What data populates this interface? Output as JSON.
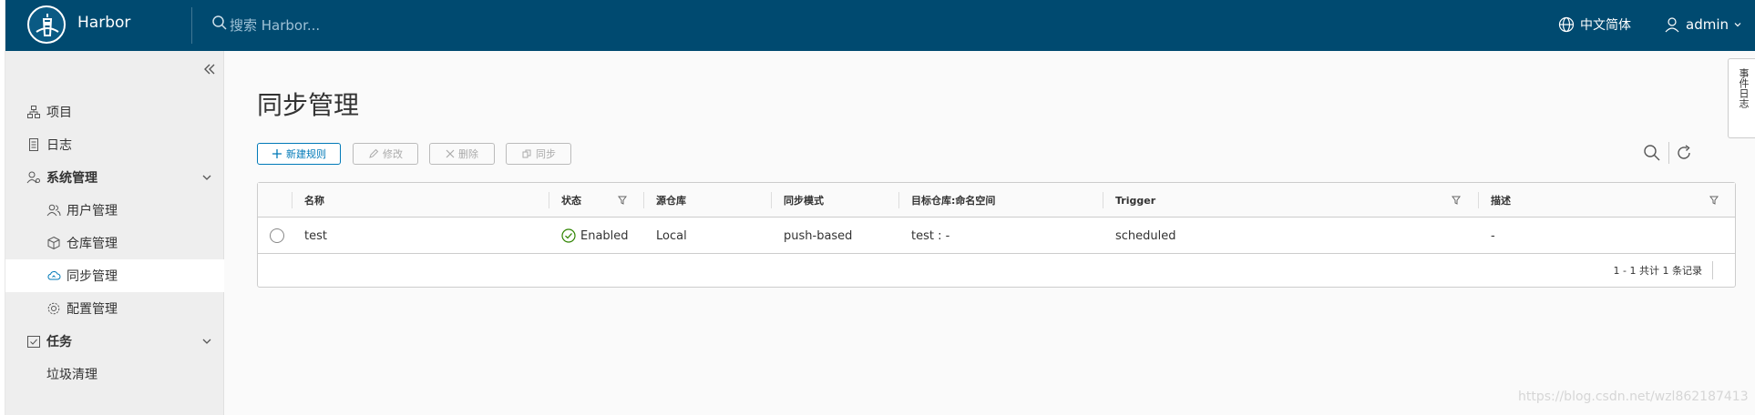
{
  "header": {
    "brand": "Harbor",
    "search_placeholder": "搜索 Harbor...",
    "language": "中文简体",
    "user": "admin"
  },
  "sidebar": {
    "items": [
      {
        "label": "项目",
        "icon": "project-icon"
      },
      {
        "label": "日志",
        "icon": "log-icon"
      },
      {
        "label": "系统管理",
        "icon": "system-admin-icon",
        "expanded": true
      },
      {
        "label": "用户管理",
        "icon": "users-icon"
      },
      {
        "label": "仓库管理",
        "icon": "registry-icon"
      },
      {
        "label": "同步管理",
        "icon": "cloud-sync-icon",
        "active": true
      },
      {
        "label": "配置管理",
        "icon": "gear-icon"
      },
      {
        "label": "任务",
        "icon": "task-icon",
        "expanded": true
      },
      {
        "label": "垃圾清理"
      }
    ]
  },
  "page": {
    "title": "同步管理"
  },
  "toolbar": {
    "new_rule": "新建规则",
    "edit": "修改",
    "delete": "删除",
    "replicate": "同步"
  },
  "table": {
    "columns": [
      "名称",
      "状态",
      "源仓库",
      "同步模式",
      "目标仓库:命名空间",
      "Trigger",
      "描述"
    ],
    "rows": [
      {
        "name": "test",
        "status": "Enabled",
        "source": "Local",
        "mode": "push-based",
        "target": "test : -",
        "trigger": "scheduled",
        "description": "-"
      }
    ],
    "pagination": "1 - 1 共计 1 条记录"
  },
  "event_log_tab": "事件日志",
  "watermark": "https://blog.csdn.net/wzl862187413",
  "colors": {
    "header_bg": "#004a70",
    "accent": "#0079b8",
    "enabled_green": "#2f8400"
  }
}
